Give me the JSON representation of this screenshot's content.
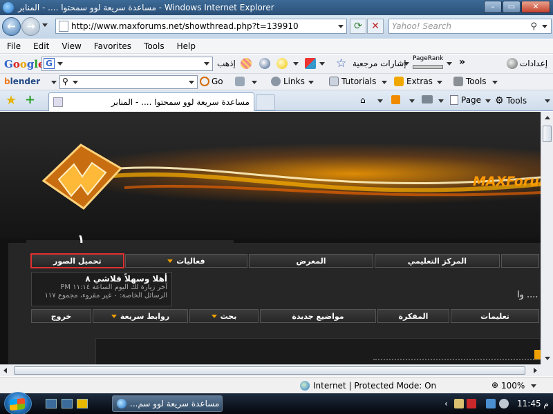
{
  "window": {
    "title": "مساعدة سريعة لوو سمحتوا .... - المنابر - Windows Internet Explorer"
  },
  "address_bar": {
    "url": "http://www.maxforums.net/showthread.php?t=139910",
    "search_placeholder": "Yahoo! Search"
  },
  "menu": [
    "File",
    "Edit",
    "View",
    "Favorites",
    "Tools",
    "Help"
  ],
  "google_toolbar": {
    "logo": "Google",
    "go_label": "إذهب",
    "bookmarks_label": "إشارات مرجعية",
    "pagerank_label": "PageRank",
    "more": "»",
    "settings_label": "إعدادات"
  },
  "links_toolbar": {
    "logo_part1": "b",
    "logo_part2": "lender",
    "go_label": "Go",
    "links_label": "Links",
    "tutorials_label": "Tutorials",
    "extras_label": "Extras",
    "tools_label": "Tools"
  },
  "tabs": {
    "active_tab": "مساعدة سريعة لوو سمحتوا .... - المنابر"
  },
  "command_bar": {
    "page_label": "Page",
    "tools_label": "Tools"
  },
  "site": {
    "brand": "MAXForums",
    "badge_digit": "١",
    "nav_top": [
      {
        "label": "تحميل الصور",
        "highlighted": true,
        "caret": false
      },
      {
        "label": "فعاليات",
        "highlighted": false,
        "caret": true
      },
      {
        "label": "المعرض",
        "highlighted": false,
        "caret": false
      },
      {
        "label": "المركز التعليمي",
        "highlighted": false,
        "caret": false
      }
    ],
    "welcome": {
      "greeting": "أهلا وسهلاً فلاشي ٨",
      "last_visit": "آخر زيارة لك اليوم الساعة ١١:١٤ PM",
      "private_messages": "الرسائل الخاصة: ٠ غير مقروء، مجموع ١١٧"
    },
    "thread_title_fragment": "وا ....",
    "nav_bottom": [
      {
        "label": "خروج",
        "caret": false
      },
      {
        "label": "روابط سريعة",
        "caret": true
      },
      {
        "label": "بحث",
        "caret": true
      },
      {
        "label": "مواضيع جديدة",
        "caret": false
      },
      {
        "label": "المفكرة",
        "caret": false
      },
      {
        "label": "تعليمات",
        "caret": false
      }
    ]
  },
  "status_bar": {
    "zone": "Internet | Protected Mode: On",
    "zoom": "100%"
  },
  "taskbar": {
    "task_label": "مساعدة سريعة لوو سم...",
    "clock": "11:45 م"
  }
}
